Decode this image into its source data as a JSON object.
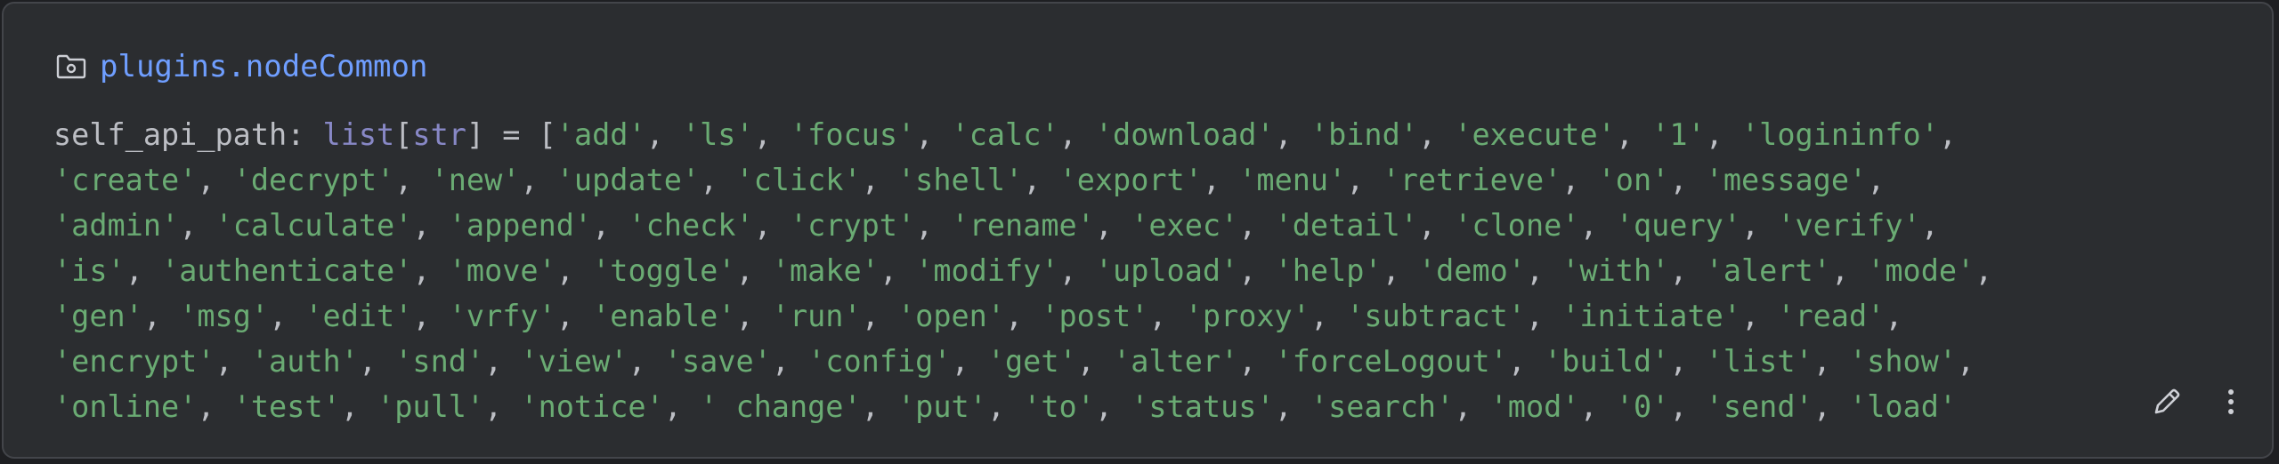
{
  "popup": {
    "module": {
      "icon": "folder-package-icon",
      "name": "plugins.nodeCommon"
    },
    "declaration": {
      "name": "self_api_path",
      "type_builtin": "list",
      "type_param": "str",
      "operator": "="
    },
    "lines": [
      [
        "add",
        "ls",
        "focus",
        "calc",
        "download",
        "bind",
        "execute",
        "1",
        "logininfo"
      ],
      [
        "create",
        "decrypt",
        "new",
        "update",
        "click",
        "shell",
        "export",
        "menu",
        "retrieve",
        "on",
        "message"
      ],
      [
        "admin",
        "calculate",
        "append",
        "check",
        "crypt",
        "rename",
        "exec",
        "detail",
        "clone",
        "query",
        "verify"
      ],
      [
        "is",
        "authenticate",
        "move",
        "toggle",
        "make",
        "modify",
        "upload",
        "help",
        "demo",
        "with",
        "alert",
        "mode"
      ],
      [
        "gen",
        "msg",
        "edit",
        "vrfy",
        "enable",
        "run",
        "open",
        "post",
        "proxy",
        "subtract",
        "initiate",
        "read"
      ],
      [
        "encrypt",
        "auth",
        "snd",
        "view",
        "save",
        "config",
        "get",
        "alter",
        "forceLogout",
        "build",
        "list",
        "show"
      ],
      [
        "online",
        "test",
        "pull",
        "notice",
        " change",
        "put",
        "to",
        "status",
        "search",
        "mod",
        "0",
        "send",
        "load"
      ]
    ],
    "actions": {
      "edit_icon": "pencil-icon",
      "more_icon": "more-vertical-icon"
    },
    "colors": {
      "background": "#2b2d30",
      "module_link": "#6f9eff",
      "string": "#6aab73",
      "builtin": "#8888c6",
      "text": "#bcbec4"
    }
  }
}
